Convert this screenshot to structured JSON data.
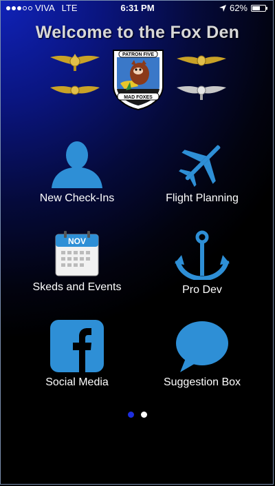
{
  "status_bar": {
    "carrier": "VIVA",
    "network": "LTE",
    "time": "6:31 PM",
    "battery": "62%",
    "battery_level": 0.62
  },
  "header": {
    "title": "Welcome to the Fox Den"
  },
  "crest": {
    "top_text": "PATRON FIVE",
    "bottom_text": "MAD FOXES"
  },
  "menu": {
    "new_checkins": "New Check-Ins",
    "flight_planning": "Flight Planning",
    "skeds_events": "Skeds and Events",
    "calendar_month": "NOV",
    "pro_dev": "Pro Dev",
    "social_media": "Social Media",
    "suggestion_box": "Suggestion Box"
  },
  "pager": {
    "current": 1,
    "total": 2
  },
  "colors": {
    "icon_blue": "#2e8fd6",
    "page_active": "#1d2ee0",
    "page_inactive": "#ffffff"
  }
}
